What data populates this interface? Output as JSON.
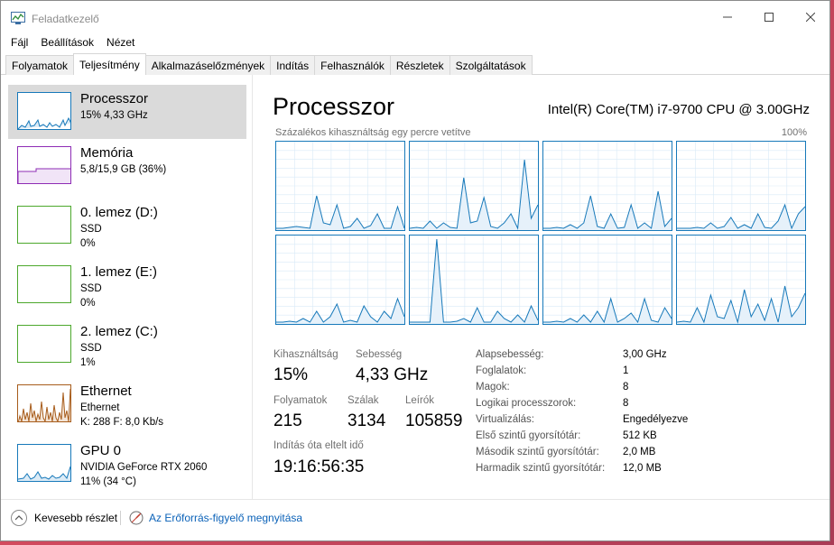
{
  "window": {
    "title": "Feladatkezelő"
  },
  "menu": [
    "Fájl",
    "Beállítások",
    "Nézet"
  ],
  "tabs": [
    "Folyamatok",
    "Teljesítmény",
    "Alkalmazáselőzmények",
    "Indítás",
    "Felhasználók",
    "Részletek",
    "Szolgáltatások"
  ],
  "active_tab": "Teljesítmény",
  "sidebar": [
    {
      "name": "Processzor",
      "sub": [
        "15% 4,33 GHz"
      ],
      "color": "#1779ba",
      "selected": true
    },
    {
      "name": "Memória",
      "sub": [
        "5,8/15,9 GB (36%)"
      ],
      "color": "#8e2cb5"
    },
    {
      "name": "0. lemez (D:)",
      "sub": [
        "SSD",
        "0%"
      ],
      "color": "#4ca82c"
    },
    {
      "name": "1. lemez (E:)",
      "sub": [
        "SSD",
        "0%"
      ],
      "color": "#4ca82c"
    },
    {
      "name": "2. lemez (C:)",
      "sub": [
        "SSD",
        "1%"
      ],
      "color": "#4ca82c"
    },
    {
      "name": "Ethernet",
      "sub": [
        "Ethernet",
        "K: 288  F: 8,0 Kb/s"
      ],
      "color": "#a75c1b"
    },
    {
      "name": "GPU 0",
      "sub": [
        "NVIDIA GeForce RTX 2060",
        "11% (34 °C)"
      ],
      "color": "#1779ba"
    }
  ],
  "main": {
    "title": "Processzor",
    "cpu_model": "Intel(R) Core(TM) i7-9700 CPU @ 3.00GHz",
    "chart_caption": "Százalékos kihasználtság egy percre vetítve",
    "chart_max": "100%",
    "stats": {
      "utilization_label": "Kihasználtság",
      "utilization": "15%",
      "speed_label": "Sebesség",
      "speed": "4,33 GHz",
      "processes_label": "Folyamatok",
      "processes": "215",
      "threads_label": "Szálak",
      "threads": "3134",
      "handles_label": "Leírók",
      "handles": "105859",
      "uptime_label": "Indítás óta eltelt idő",
      "uptime": "19:16:56:35"
    },
    "specs": [
      {
        "label": "Alapsebesség:",
        "value": "3,00 GHz"
      },
      {
        "label": "Foglalatok:",
        "value": "1"
      },
      {
        "label": "Magok:",
        "value": "8"
      },
      {
        "label": "Logikai processzorok:",
        "value": "8"
      },
      {
        "label": "Virtualizálás:",
        "value": "Engedélyezve"
      },
      {
        "label": "Első szintű gyorsítótár:",
        "value": "512 KB"
      },
      {
        "label": "Második szintű gyorsítótár:",
        "value": "2,0 MB"
      },
      {
        "label": "Harmadik szintű gyorsítótár:",
        "value": "12,0 MB"
      }
    ]
  },
  "footer": {
    "fewer_details": "Kevesebb részlet",
    "resource_monitor": "Az Erőforrás-figyelő megnyitása"
  },
  "colors": {
    "cpu": "#1779ba",
    "memory": "#8e2cb5",
    "disk": "#4ca82c",
    "ethernet": "#a75c1b",
    "link": "#0b62b8"
  }
}
